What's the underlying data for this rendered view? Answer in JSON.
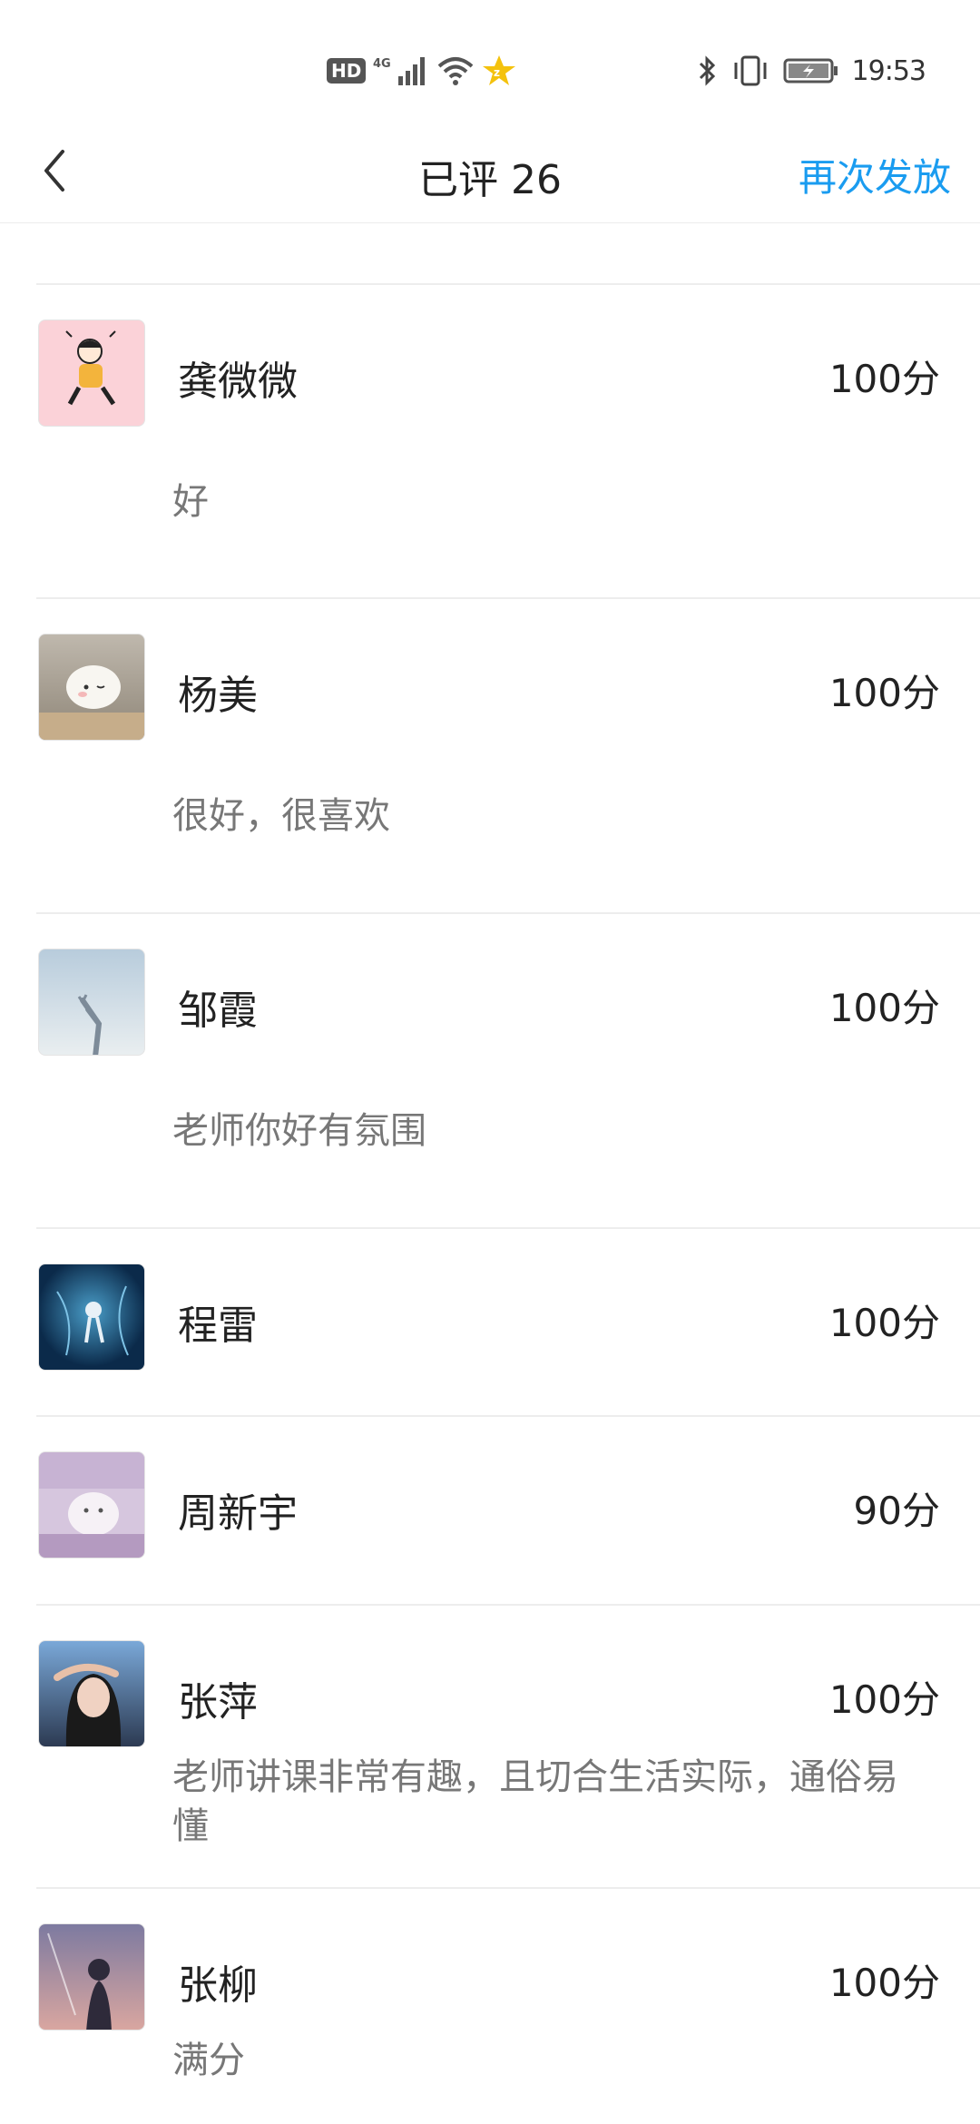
{
  "status_bar": {
    "left_icons": [
      "hd-badge",
      "4g-signal-icon",
      "wifi-icon",
      "star-badge-icon"
    ],
    "hd_label": "HD",
    "right_icons": [
      "bluetooth-icon",
      "vibrate-icon",
      "battery-icon"
    ],
    "time": "19:53"
  },
  "nav": {
    "title": "已评 26",
    "action": "再次发放"
  },
  "items": [
    {
      "name": "龚微微",
      "score": "100分",
      "comment": "好"
    },
    {
      "name": "杨美",
      "score": "100分",
      "comment": "很好，很喜欢"
    },
    {
      "name": "邹霞",
      "score": "100分",
      "comment": "老师你好有氛围"
    },
    {
      "name": "程雷",
      "score": "100分",
      "comment": ""
    },
    {
      "name": "周新宇",
      "score": "90分",
      "comment": ""
    },
    {
      "name": "张萍",
      "score": "100分",
      "comment": "老师讲课非常有趣，且切合生活实际，通俗易懂"
    },
    {
      "name": "张柳",
      "score": "100分",
      "comment": "满分"
    }
  ]
}
